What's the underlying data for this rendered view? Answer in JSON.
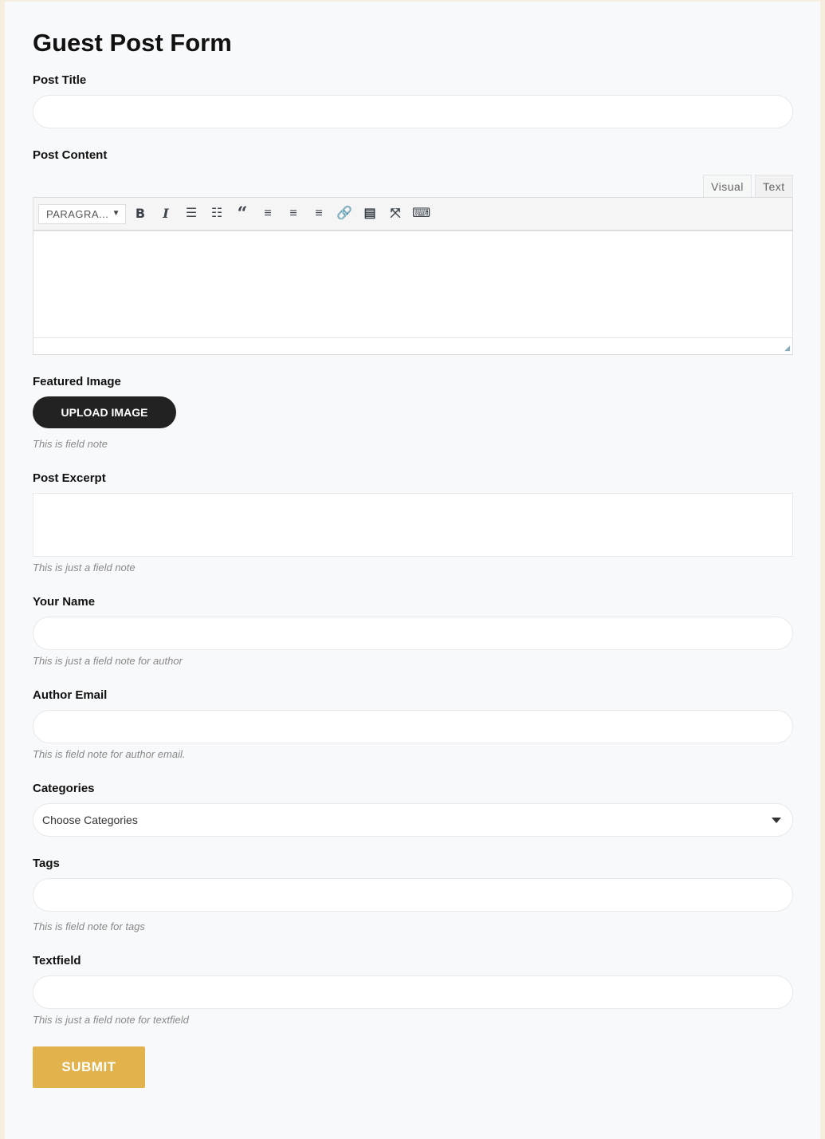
{
  "title": "Guest Post Form",
  "post_title": {
    "label": "Post Title",
    "value": ""
  },
  "post_content": {
    "label": "Post Content",
    "tabs": [
      "Visual",
      "Text"
    ],
    "active_tab": "Visual",
    "format_select": "PARAGRA...",
    "toolbar_icons": [
      "bold-icon",
      "italic-icon",
      "bullet-list-icon",
      "numbered-list-icon",
      "blockquote-icon",
      "align-left-icon",
      "align-center-icon",
      "align-right-icon",
      "link-icon",
      "read-more-icon",
      "fullscreen-icon",
      "toolbar-toggle-icon"
    ]
  },
  "featured_image": {
    "label": "Featured Image",
    "button": "UPLOAD IMAGE",
    "note": "This is field note"
  },
  "post_excerpt": {
    "label": "Post Excerpt",
    "note": "This is just a field note"
  },
  "your_name": {
    "label": "Your Name",
    "note": "This is just a field note for author"
  },
  "author_email": {
    "label": "Author Email",
    "note": "This is field note for author email."
  },
  "categories": {
    "label": "Categories",
    "selected": "Choose Categories"
  },
  "tags": {
    "label": "Tags",
    "note": "This is field note for tags"
  },
  "textfield": {
    "label": "Textfield",
    "note": "This is just a field note for textfield"
  },
  "submit": "SUBMIT",
  "colors": {
    "submit": "#e2b24c",
    "upload": "#222222",
    "background": "#f8f9fb"
  }
}
